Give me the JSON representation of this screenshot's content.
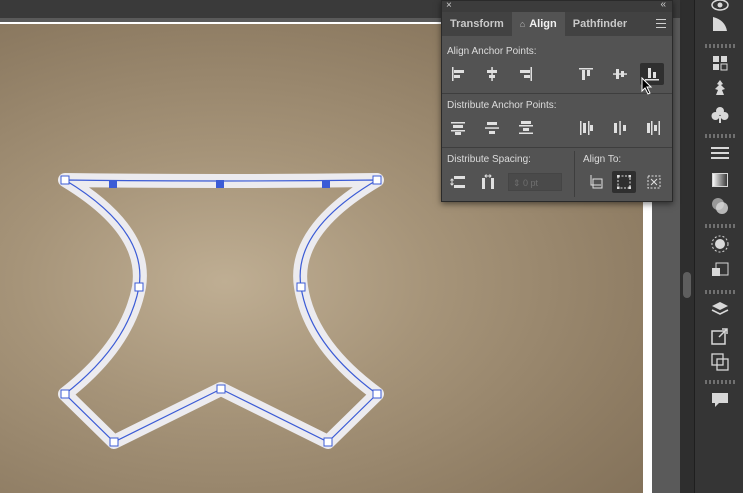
{
  "panel": {
    "tabs": [
      {
        "label": "Transform",
        "active": false
      },
      {
        "label": "Align",
        "active": true
      },
      {
        "label": "Pathfinder",
        "active": false
      }
    ],
    "align_tab_icon": "⌂",
    "close_glyph": "×",
    "collapse_glyph": "«",
    "sections": {
      "align_anchor": "Align Anchor Points:",
      "distribute_anchor": "Distribute Anchor Points:",
      "distribute_spacing": "Distribute Spacing:",
      "align_to": "Align To:"
    },
    "spacing_value": "⇕ 0 pt",
    "active_button": "align-bottom-button",
    "active_align_to": "align-to-selection-button"
  },
  "icons": {
    "panel_menu": "hamburger-icon",
    "cursor": "arrow-cursor-icon"
  },
  "colors": {
    "accent_path": "#3b5bd6",
    "panel_bg": "#535353",
    "texture": "#a69479"
  }
}
